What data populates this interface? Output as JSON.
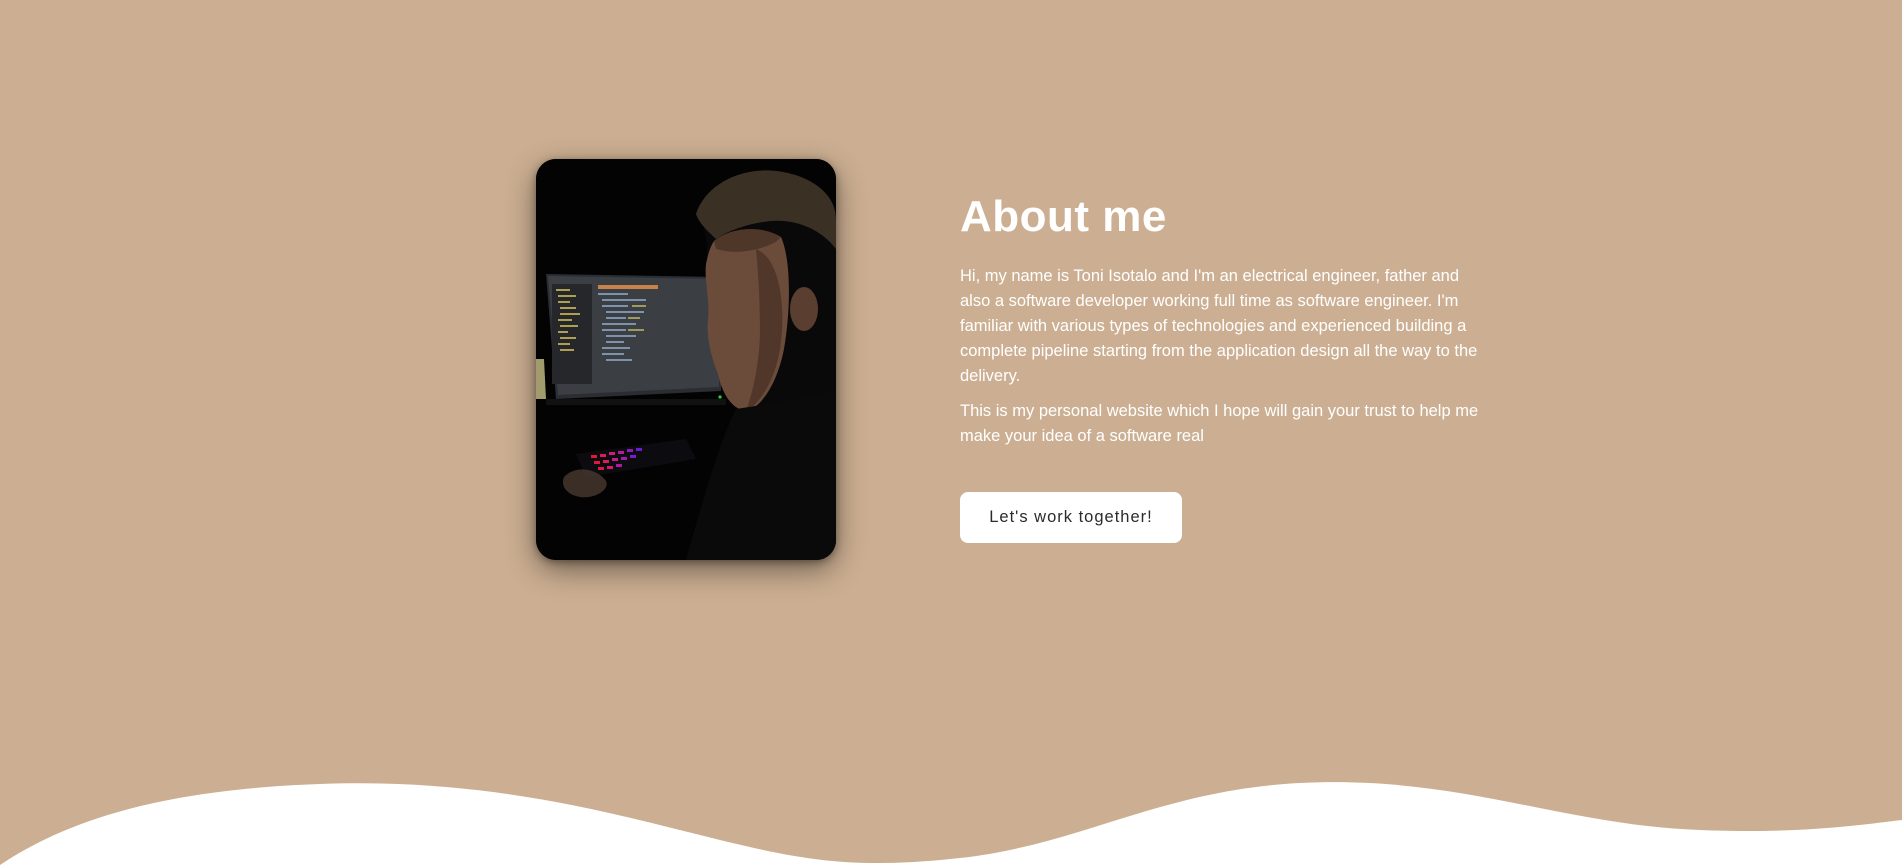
{
  "about": {
    "title": "About me",
    "paragraph_1": "Hi, my name is Toni Isotalo and I'm an electrical engineer, father and also a software developer working full time as software engineer. I'm familiar with various types of technologies and experienced building a complete pipeline starting from the application design all the way to the delivery.",
    "paragraph_2": "This is my personal website which I hope will gain your trust to help me make your idea of a software real",
    "cta_label": "Let's work together!"
  },
  "colors": {
    "background": "#ccaf92",
    "text": "#ffffff",
    "button_bg": "#ffffff",
    "button_text": "#2b2b2b",
    "wave": "#ffffff"
  }
}
